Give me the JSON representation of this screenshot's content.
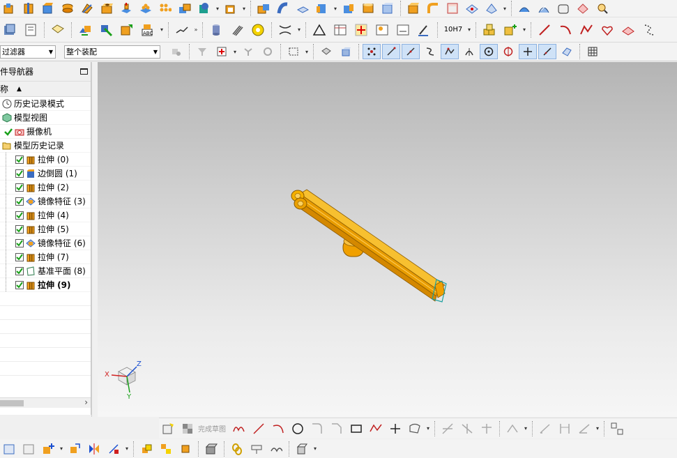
{
  "filters": {
    "type_filter_value": "过滤器",
    "scope_filter_value": "整个装配"
  },
  "toolbar2": {
    "fit_label": "10H7"
  },
  "navigator": {
    "title": "件导航器",
    "column_name": "称",
    "items": [
      {
        "label": "历史记录模式",
        "icon": "clock-icon",
        "checked": false,
        "bold": false
      },
      {
        "label": "模型视图",
        "icon": "model-views-icon",
        "checked": false,
        "bold": false
      },
      {
        "label": "摄像机",
        "icon": "camera-icon",
        "checked": true,
        "bold": false
      },
      {
        "label": "模型历史记录",
        "icon": "folder-open-icon",
        "checked": false,
        "bold": false
      },
      {
        "label": "拉伸 (0)",
        "icon": "extrude-icon",
        "checked": true,
        "bold": false
      },
      {
        "label": "边倒圆 (1)",
        "icon": "edge-blend-icon",
        "checked": true,
        "bold": false
      },
      {
        "label": "拉伸 (2)",
        "icon": "extrude-icon",
        "checked": true,
        "bold": false
      },
      {
        "label": "镜像特征 (3)",
        "icon": "mirror-feature-icon",
        "checked": true,
        "bold": false
      },
      {
        "label": "拉伸 (4)",
        "icon": "extrude-icon",
        "checked": true,
        "bold": false
      },
      {
        "label": "拉伸 (5)",
        "icon": "extrude-icon",
        "checked": true,
        "bold": false
      },
      {
        "label": "镜像特征 (6)",
        "icon": "mirror-feature-icon",
        "checked": true,
        "bold": false
      },
      {
        "label": "拉伸 (7)",
        "icon": "extrude-icon",
        "checked": true,
        "bold": false
      },
      {
        "label": "基准平面 (8)",
        "icon": "datum-plane-icon",
        "checked": true,
        "bold": false
      },
      {
        "label": "拉伸 (9)",
        "icon": "extrude-icon",
        "checked": true,
        "bold": true
      }
    ]
  },
  "triad": {
    "x_label": "X",
    "y_label": "Y",
    "z_label": "Z"
  },
  "sketch_toolbar": {
    "finish_sketch_label": "完成草图"
  },
  "colors": {
    "model_orange": "#f5a800",
    "model_edge": "#8a5a00",
    "check_green": "#1aa01a",
    "extrude_orange": "#f0a020"
  }
}
